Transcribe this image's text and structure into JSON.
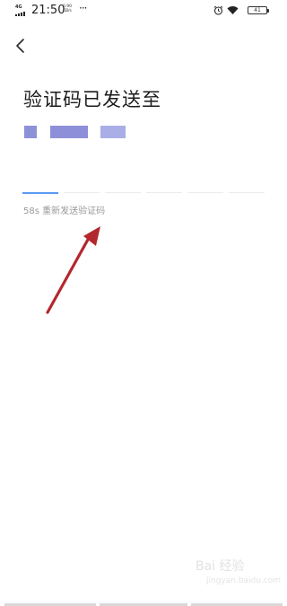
{
  "status_bar": {
    "network_label": "4G",
    "time": "21:50",
    "speed": "0.90 KB/s",
    "more": "···",
    "battery": "41"
  },
  "header": {
    "back_icon": "chevron-left-icon"
  },
  "main": {
    "title": "验证码已发送至",
    "masked_number_colors": [
      "#8d92d8",
      "#8d90d8",
      "#aaaee6"
    ],
    "code_slots": 6,
    "resend_text": "58s 重新发送验证码"
  },
  "watermark": {
    "text": "Bai 经验",
    "sub": "jingyan.baidu.com"
  },
  "colors": {
    "accent": "#5b9af2",
    "annotation_arrow": "#b3282e"
  }
}
